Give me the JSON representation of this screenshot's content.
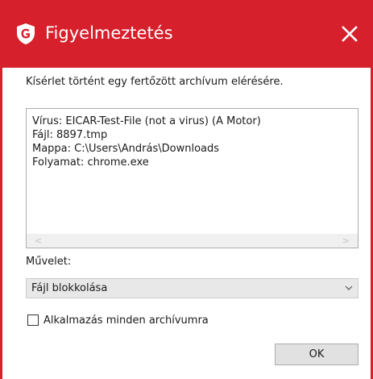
{
  "window": {
    "title": "Figyelmeztetés",
    "accent_color": "#d6202c",
    "app_icon": "gdata-shield-icon",
    "close_icon": "close-icon"
  },
  "message": "Kísérlet történt egy fertőzött archívum elérésére.",
  "details": {
    "lines": [
      "Vírus: EICAR-Test-File (not a virus) (A Motor)",
      "Fájl: 8897.tmp",
      "Mappa: C:\\Users\\András\\Downloads",
      "Folyamat: chrome.exe"
    ],
    "scroll_left_glyph": "<",
    "scroll_right_glyph": ">"
  },
  "operation": {
    "label": "Művelet:",
    "selected": "Fájl blokkolása"
  },
  "apply_all": {
    "label": "Alkalmazás minden archívumra",
    "checked": false
  },
  "ok_button": "OK"
}
